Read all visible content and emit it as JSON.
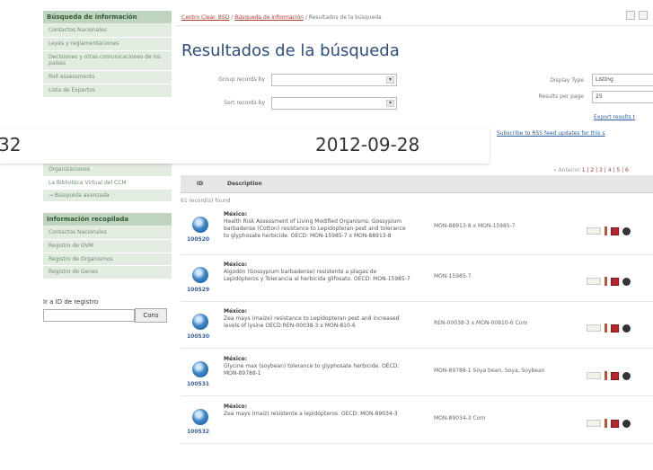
{
  "sidebar": {
    "block1": {
      "header": "Búsqueda de información",
      "items": [
        "Contactos Nacionales",
        "Leyes y reglamentaciones",
        "Decisiones y otras comunicaciones de los países",
        "Roll assessments",
        "Lista de Expertos"
      ]
    },
    "block2": {
      "items": [
        "Organizaciones",
        "La Biblioteca Virtual del CCM",
        "→ Búsqueda avanzada"
      ]
    },
    "block3": {
      "header": "Información recopilada",
      "items": [
        "Contactos Nacionales",
        "Registro de OVM",
        "Registro de Organismos",
        "Registro de Genes"
      ]
    },
    "registry": {
      "label": "Ir a ID de registro",
      "button": "Cons"
    }
  },
  "breadcrumb": {
    "home": "Centro Clear. BSD",
    "search": "Búsqueda de información",
    "current": "Resultados de la búsqueda"
  },
  "page_title": "Resultados de la búsqueda",
  "form": {
    "group_label": "Group records by",
    "sort_label": "Sort records by",
    "display_label": "Display Type",
    "display_value": "Listing",
    "rpp_label": "Results per page",
    "rpp_value": "25",
    "export_link": "Export results t",
    "subscribe_link": "Subscribe to RSS feed updates for this s"
  },
  "overlay": {
    "left_text": "32",
    "date_text": "2012-09-28"
  },
  "pager": {
    "prev": "« Anterior",
    "pages": "1 | 2 | 3 | 4 | 5 | 6"
  },
  "table": {
    "col_id": "ID",
    "col_desc": "Description",
    "found": "61 record(s) found",
    "rows": [
      {
        "id": "100520",
        "country": "México:",
        "desc": "Health Risk Assessment of Living Modified Organisms: Gossypium barbadense (Cotton) resistance to Lepidopteran pest and tolerance to glyphosate herbicide. OECD: MON-15985-7 x MON-88913-8",
        "code": "MON-88913-8 x MON-15985-7"
      },
      {
        "id": "100529",
        "country": "México:",
        "desc": "Algodón (Gossypium barbadense) resistente a plagas de Lepidópteros y Tolerancia al herbicida glifosato. OECD: MON-15985-7",
        "code": "MON-15985-7"
      },
      {
        "id": "100530",
        "country": "México:",
        "desc": "Zea mays (maize) resistance to Lepidopteran pest and increased levels of lysine OECD:REN-00038-3 x MON-810-6",
        "code": "REN-00038-3 x MON-00810-6 Corn"
      },
      {
        "id": "100531",
        "country": "México:",
        "desc": "Glycine max (soybean) tolerance to glyphosate herbicide. OECD: MON-89788-1",
        "code": "MON-89788-1 Soya bean, Soya, Soybean"
      },
      {
        "id": "100532",
        "country": "México:",
        "desc": "Zea mays (maiz) resistente a lepidópteros. OECD: MON-89034-3",
        "code": "MON-89034-3 Corn"
      }
    ]
  }
}
